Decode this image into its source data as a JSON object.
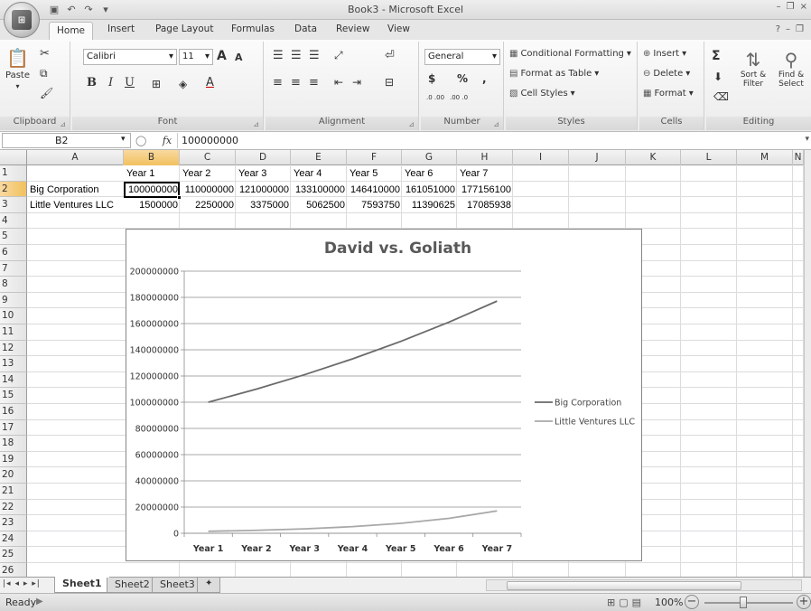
{
  "window": {
    "title": "Book3 - Microsoft Excel"
  },
  "qat": {
    "save_icon": "save-icon",
    "undo_glyph": "↶",
    "redo_glyph": "↷"
  },
  "tabs": [
    "Home",
    "Insert",
    "Page Layout",
    "Formulas",
    "Data",
    "Review",
    "View"
  ],
  "ribbon": {
    "clipboard": {
      "label": "Clipboard",
      "paste": "Paste"
    },
    "font": {
      "label": "Font",
      "family": "Calibri",
      "size": "11",
      "bold": "B",
      "italic": "I",
      "underline": "U",
      "grow": "A",
      "shrink": "A"
    },
    "alignment": {
      "label": "Alignment"
    },
    "number": {
      "label": "Number",
      "format": "General",
      "currency": "$",
      "percent": "%",
      "comma": ",",
      "inc_decimal": ".0 .00",
      "dec_decimal": ".00 .0"
    },
    "styles": {
      "label": "Styles",
      "conditional": "Conditional Formatting",
      "format_table": "Format as Table",
      "cell_styles": "Cell Styles"
    },
    "cells": {
      "label": "Cells",
      "insert": "Insert",
      "delete": "Delete",
      "format": "Format"
    },
    "editing": {
      "label": "Editing",
      "sigma": "Σ",
      "sort_filter": "Sort & Filter",
      "find_select": "Find & Select"
    }
  },
  "formula_bar": {
    "name_box": "B2",
    "fx": "fx",
    "value": "100000000"
  },
  "columns": [
    "A",
    "B",
    "C",
    "D",
    "E",
    "F",
    "G",
    "H",
    "I",
    "J",
    "K",
    "L",
    "M",
    "N"
  ],
  "rows": [
    "1",
    "2",
    "3",
    "4",
    "5",
    "6",
    "7",
    "8",
    "9",
    "10",
    "11",
    "12",
    "13",
    "14",
    "15",
    "16",
    "17",
    "18",
    "19",
    "20",
    "21",
    "22",
    "23",
    "24",
    "25",
    "26"
  ],
  "cells": {
    "row1": [
      "",
      "Year 1",
      "Year 2",
      "Year 3",
      "Year 4",
      "Year 5",
      "Year 6",
      "Year 7"
    ],
    "row2": [
      "Big Corporation",
      "100000000",
      "110000000",
      "121000000",
      "133100000",
      "146410000",
      "161051000",
      "177156100"
    ],
    "row3": [
      "Little Ventures LLC",
      "1500000",
      "2250000",
      "3375000",
      "5062500",
      "7593750",
      "11390625",
      "17085938"
    ]
  },
  "chart_data": {
    "type": "line",
    "title": "David vs. Goliath",
    "categories": [
      "Year 1",
      "Year 2",
      "Year 3",
      "Year 4",
      "Year 5",
      "Year 6",
      "Year 7"
    ],
    "series": [
      {
        "name": "Big Corporation",
        "values": [
          100000000,
          110000000,
          121000000,
          133100000,
          146410000,
          161051000,
          177156100
        ],
        "color": "#6a6a6a"
      },
      {
        "name": "Little Ventures LLC",
        "values": [
          1500000,
          2250000,
          3375000,
          5062500,
          7593750,
          11390625,
          17085938
        ],
        "color": "#a8a8a8"
      }
    ],
    "ylim": [
      0,
      200000000
    ],
    "yticks": [
      "0",
      "20000000",
      "40000000",
      "60000000",
      "80000000",
      "100000000",
      "120000000",
      "140000000",
      "160000000",
      "180000000",
      "200000000"
    ],
    "grid": true,
    "legend": "right"
  },
  "sheets": [
    "Sheet1",
    "Sheet2",
    "Sheet3"
  ],
  "status": {
    "text": "Ready",
    "zoom": "100%",
    "zoom_out": "−",
    "zoom_in": "+"
  }
}
